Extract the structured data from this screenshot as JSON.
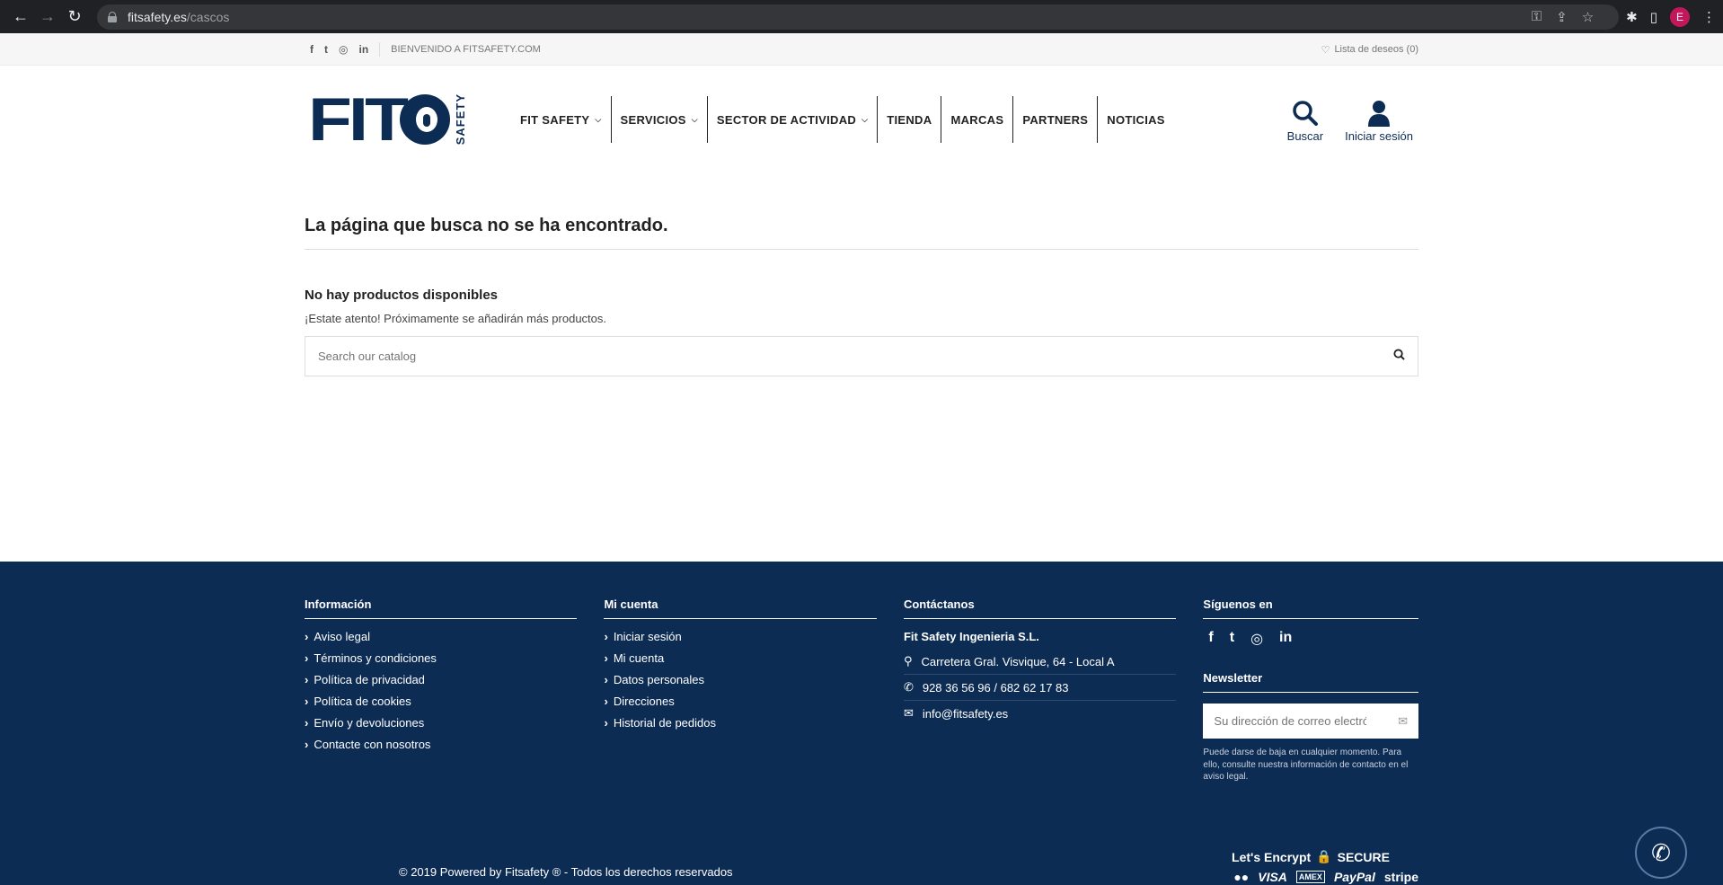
{
  "browser": {
    "url_domain": "fitsafety.es",
    "url_path": "/cascos",
    "profile_initial": "E"
  },
  "topbar": {
    "welcome": "BIENVENIDO A FITSAFETY.COM",
    "wishlist": "Lista de deseos (0)"
  },
  "logo": {
    "text": "FIT",
    "sub": "SAFETY"
  },
  "nav": {
    "items": [
      {
        "label": "FIT SAFETY",
        "has_dropdown": true
      },
      {
        "label": "SERVICIOS",
        "has_dropdown": true
      },
      {
        "label": "SECTOR DE ACTIVIDAD",
        "has_dropdown": true
      },
      {
        "label": "TIENDA",
        "has_dropdown": false
      },
      {
        "label": "MARCAS",
        "has_dropdown": false
      },
      {
        "label": "PARTNERS",
        "has_dropdown": false
      },
      {
        "label": "NOTICIAS",
        "has_dropdown": false
      }
    ],
    "search_label": "Buscar",
    "login_label": "Iniciar sesión"
  },
  "main": {
    "title": "La página que busca no se ha encontrado.",
    "no_products": "No hay productos disponibles",
    "soon": "¡Estate atento! Próximamente se añadirán más productos.",
    "search_placeholder": "Search our catalog"
  },
  "footer": {
    "info": {
      "title": "Información",
      "links": [
        "Aviso legal",
        "Términos y condiciones",
        "Política de privacidad",
        "Política de cookies",
        "Envío y devoluciones",
        "Contacte con nosotros"
      ]
    },
    "account": {
      "title": "Mi cuenta",
      "links": [
        "Iniciar sesión",
        "Mi cuenta",
        "Datos personales",
        "Direcciones",
        "Historial de pedidos"
      ]
    },
    "contact": {
      "title": "Contáctanos",
      "company": "Fit Safety Ingenieria S.L.",
      "address": "Carretera Gral. Visvique, 64 - Local A",
      "phone": "928 36 56 96 / 682 62 17 83",
      "email": "info@fitsafety.es"
    },
    "follow": {
      "title": "Síguenos en"
    },
    "newsletter": {
      "title": "Newsletter",
      "placeholder": "Su dirección de correo electrónico",
      "note": "Puede darse de baja en cualquier momento. Para ello, consulte nuestra información de contacto en el aviso legal."
    },
    "copyright": "© 2019 Powered by Fitsafety ® - Todos los derechos reservados",
    "security": {
      "lets_encrypt": "Let's Encrypt",
      "secure": "SECURE",
      "payments": [
        "VISA",
        "PayPal",
        "stripe"
      ]
    }
  },
  "colors": {
    "brand": "#0d2c54",
    "chrome": "#202124"
  }
}
